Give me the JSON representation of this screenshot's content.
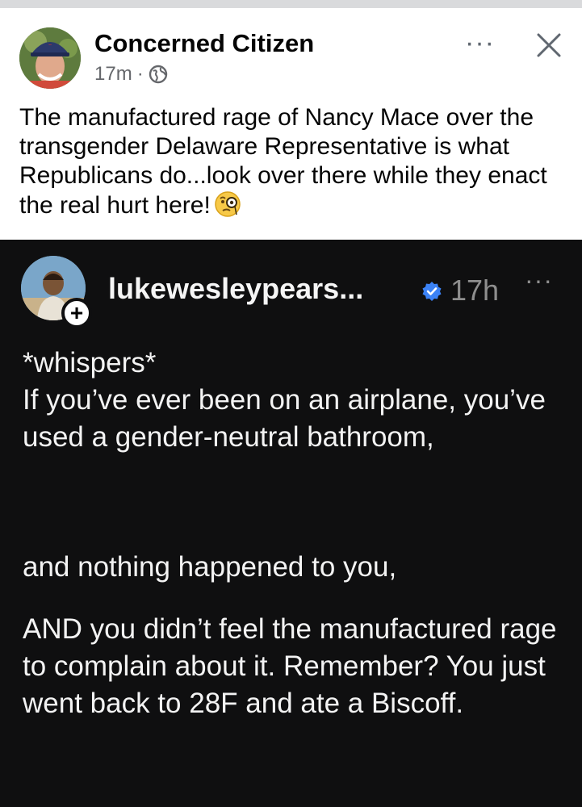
{
  "facebook_post": {
    "author": "Concerned Citizen",
    "time": "17m",
    "time_separator": "·",
    "text": "The manufactured rage of Nancy Mace over the transgender Delaware Representative is what Republicans do...look over there while they enact the real hurt here!",
    "emoji_icon": "face-with-monocle-emoji",
    "more_label": "···",
    "privacy_icon": "globe-icon",
    "close_icon": "close-icon"
  },
  "embedded_post": {
    "username": "lukewesleypears...",
    "time": "17h",
    "more_label": "···",
    "follow_label": "+",
    "verified_icon": "verified-badge-icon",
    "paragraphs": [
      "*whispers*\nIf you’ve ever been on an airplane, you’ve used a gender-neutral bathroom,",
      "and nothing happened to you,",
      "AND you didn’t feel the manufactured rage to complain about it. Remember? You just went back to 28F and ate a Biscoff."
    ]
  },
  "colors": {
    "embedded_background": "#0f0f10",
    "verified_blue": "#3b82f6",
    "meta_gray": "#65676b"
  }
}
